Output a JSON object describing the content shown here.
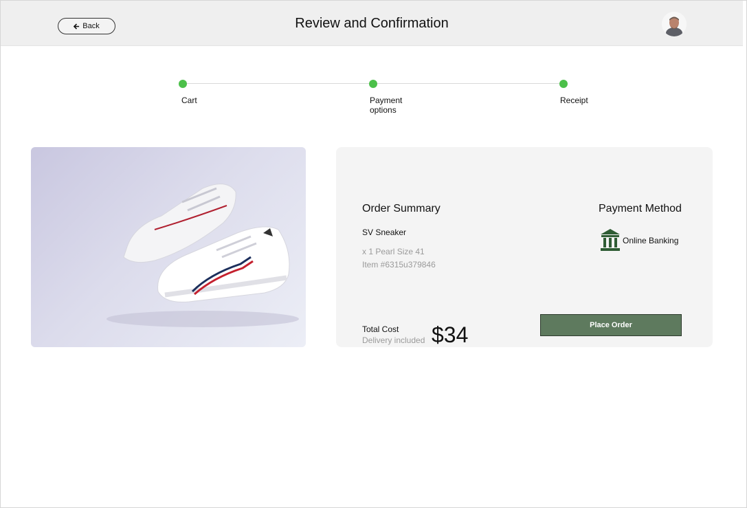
{
  "header": {
    "back_label": "Back",
    "title": "Review and Confirmation",
    "avatar_icon": "user-avatar"
  },
  "stepper": {
    "steps": [
      {
        "label": "Cart",
        "status": "complete"
      },
      {
        "label": "Payment options",
        "status": "complete"
      },
      {
        "label": "Receipt",
        "status": "complete"
      }
    ],
    "active_color": "#4cc04a"
  },
  "product": {
    "image_icon": "sneaker-photo"
  },
  "order_summary": {
    "title": "Order Summary",
    "item_name": "SV Sneaker",
    "item_detail": "x 1 Pearl Size 41",
    "item_number": "Item #6315u379846",
    "total_label": "Total Cost",
    "delivery_note": "Delivery included",
    "total_price": "$34"
  },
  "payment": {
    "title": "Payment Method",
    "method_label": "Online Banking",
    "method_icon": "bank-icon",
    "icon_color": "#2f5d34"
  },
  "actions": {
    "place_order_label": "Place Order",
    "place_order_color": "#5e7a5e"
  }
}
